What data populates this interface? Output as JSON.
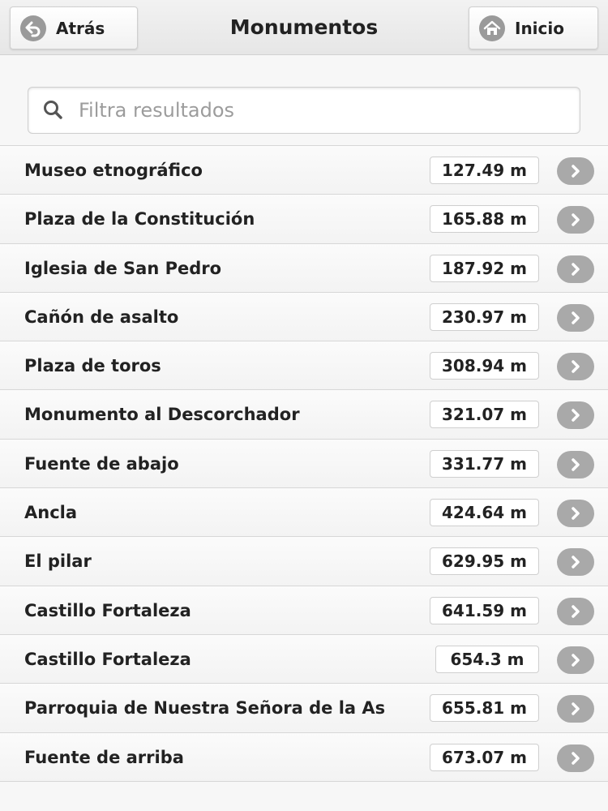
{
  "header": {
    "back_label": "Atrás",
    "title": "Monumentos",
    "home_label": "Inicio"
  },
  "search": {
    "placeholder": "Filtra resultados",
    "value": ""
  },
  "icons": {
    "back": "arrow-left-icon",
    "home": "home-icon",
    "search": "search-icon",
    "row_arrow": "chevron-right-icon"
  },
  "colors": {
    "icon_gray": "#9a9a9a",
    "divider": "#d7d7d7"
  },
  "items": [
    {
      "name": "Museo etnográfico",
      "distance": "127.49 m"
    },
    {
      "name": "Plaza de la Constitución",
      "distance": "165.88 m"
    },
    {
      "name": "Iglesia de San Pedro",
      "distance": "187.92 m"
    },
    {
      "name": "Cañón de asalto",
      "distance": "230.97 m"
    },
    {
      "name": "Plaza de toros",
      "distance": "308.94 m"
    },
    {
      "name": "Monumento al Descorchador",
      "distance": "321.07 m"
    },
    {
      "name": "Fuente de abajo",
      "distance": "331.77 m"
    },
    {
      "name": "Ancla",
      "distance": "424.64 m"
    },
    {
      "name": "El pilar",
      "distance": "629.95 m"
    },
    {
      "name": "Castillo Fortaleza",
      "distance": "641.59 m"
    },
    {
      "name": "Castillo Fortaleza",
      "distance": "654.3 m"
    },
    {
      "name": "Parroquia de Nuestra Señora de la As",
      "distance": "655.81 m"
    },
    {
      "name": "Fuente de arriba",
      "distance": "673.07 m"
    }
  ]
}
